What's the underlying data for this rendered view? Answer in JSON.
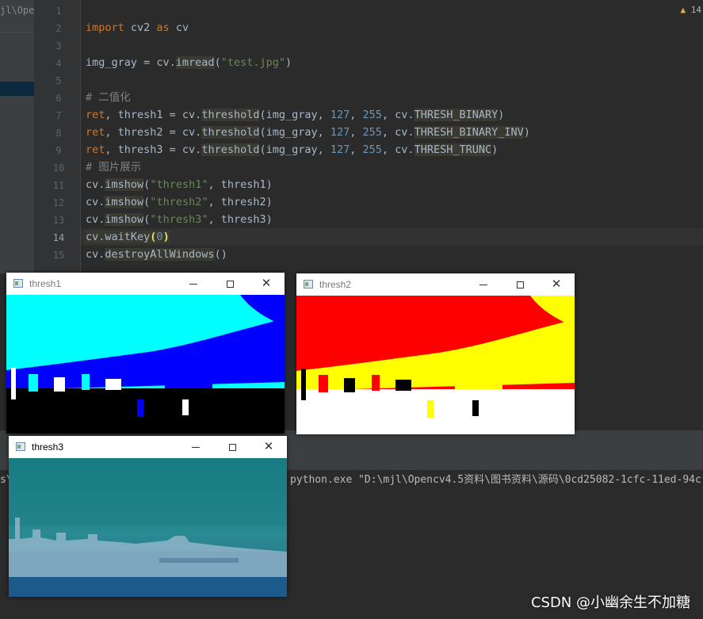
{
  "project": {
    "path_crumb": "jl\\Open"
  },
  "editor": {
    "line_numbers": [
      "1",
      "2",
      "3",
      "4",
      "5",
      "6",
      "7",
      "8",
      "9",
      "10",
      "11",
      "12",
      "13",
      "14",
      "15"
    ],
    "current_line": 14,
    "warning_count": "14",
    "code": {
      "l2_kw_import": "import",
      "l2_mod": " cv2 ",
      "l2_kw_as": "as",
      "l2_alias": " cv",
      "l4_a": "img_gray = cv.",
      "l4_fn": "imread",
      "l4_open": "(",
      "l4_str": "\"test.jpg\"",
      "l4_close": ")",
      "l6_comment": "# 二值化",
      "l7_a": "ret",
      "l7_b": ", thresh1 = cv.",
      "l7_fn": "threshold",
      "l7_c": "(img_gray, ",
      "l7_n1": "127",
      "l7_sep": ", ",
      "l7_n2": "255",
      "l7_d": ", cv.",
      "l7_const": "THRESH_BINARY",
      "l7_e": ")",
      "l8_a": "ret",
      "l8_b": ", thresh2 = cv.",
      "l8_fn": "threshold",
      "l8_c": "(img_gray, ",
      "l8_n1": "127",
      "l8_sep": ", ",
      "l8_n2": "255",
      "l8_d": ", cv.",
      "l8_const": "THRESH_BINARY_INV",
      "l8_e": ")",
      "l9_a": "ret",
      "l9_b": ", thresh3 = cv.",
      "l9_fn": "threshold",
      "l9_c": "(img_gray, ",
      "l9_n1": "127",
      "l9_sep": ", ",
      "l9_n2": "255",
      "l9_d": ", cv.",
      "l9_const": "THRESH_TRUNC",
      "l9_e": ")",
      "l10_comment": "# 图片展示",
      "l11_a": "cv.",
      "l11_fn": "imshow",
      "l11_b": "(",
      "l11_str": "\"thresh1\"",
      "l11_c": ", thresh1)",
      "l12_a": "cv.",
      "l12_fn": "imshow",
      "l12_b": "(",
      "l12_str": "\"thresh2\"",
      "l12_c": ", thresh2)",
      "l13_a": "cv.",
      "l13_fn": "imshow",
      "l13_b": "(",
      "l13_str": "\"thresh3\"",
      "l13_c": ", thresh3)",
      "l14_a": "cv.waitKey",
      "l14_open": "(",
      "l14_num": "0",
      "l14_close": ")",
      "l15_a": "cv.",
      "l15_fn": "destroyAllWindows",
      "l15_b": "()"
    }
  },
  "console": {
    "prefix": "s\\",
    "command": "python.exe \"D:\\mjl\\Opencv4.5资料\\图书资料\\源码\\0cd25082-1cfc-11ed-94c"
  },
  "windows": [
    {
      "title": "thresh1"
    },
    {
      "title": "thresh2"
    },
    {
      "title": "thresh3"
    }
  ],
  "colors": {
    "thresh1_sky": "#00ffff",
    "thresh1_mid": "#0000ff",
    "thresh2_sky": "#ff0000",
    "thresh2_mid": "#ffff00",
    "thresh3_tint": "#1d7d86"
  },
  "watermark": "CSDN @小幽余生不加糖"
}
